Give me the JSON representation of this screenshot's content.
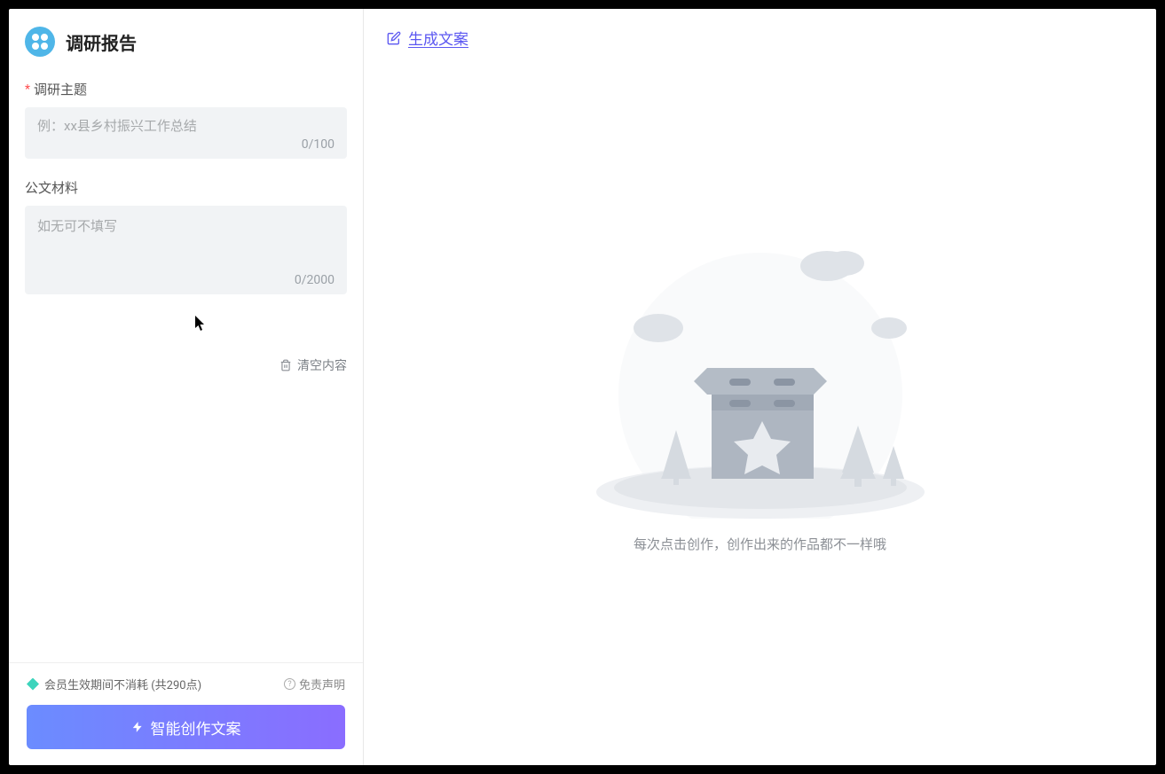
{
  "header": {
    "title": "调研报告"
  },
  "form": {
    "topic": {
      "label": "调研主题",
      "placeholder": "例：xx县乡村振兴工作总结",
      "value": "",
      "counter": "0/100"
    },
    "material": {
      "label": "公文材料",
      "placeholder": "如无可不填写",
      "value": "",
      "counter": "0/2000"
    },
    "clear_label": "清空内容"
  },
  "footer": {
    "member_text": "会员生效期间不消耗 (共290点)",
    "disclaimer": "免责声明",
    "generate_label": "智能创作文案"
  },
  "main": {
    "header_title": "生成文案",
    "empty_text": "每次点击创作，创作出来的作品都不一样哦"
  }
}
